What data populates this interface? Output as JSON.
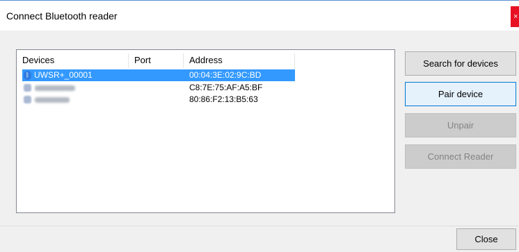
{
  "window": {
    "title": "Connect Bluetooth reader",
    "close_glyph": "×"
  },
  "device_list": {
    "columns": [
      "Devices",
      "Port",
      "Address"
    ],
    "rows": [
      {
        "device": "UWSR+_00001",
        "port": "",
        "address": "00:04:3E:02:9C:BD",
        "icon": "bluetooth-icon",
        "selected": true
      },
      {
        "device": "",
        "port": "",
        "address": "C8:7E:75:AF:A5:BF",
        "icon": "bluetooth-device-icon",
        "selected": false
      },
      {
        "device": "",
        "port": "",
        "address": "80:86:F2:13:B5:63",
        "icon": "bluetooth-device-icon",
        "selected": false
      }
    ]
  },
  "buttons": {
    "search": "Search for devices",
    "pair": "Pair device",
    "unpair": "Unpair",
    "connect": "Connect Reader",
    "close": "Close"
  },
  "colors": {
    "selection": "#3399ff",
    "default_button_border": "#0078d7",
    "close_button": "#e81123"
  }
}
